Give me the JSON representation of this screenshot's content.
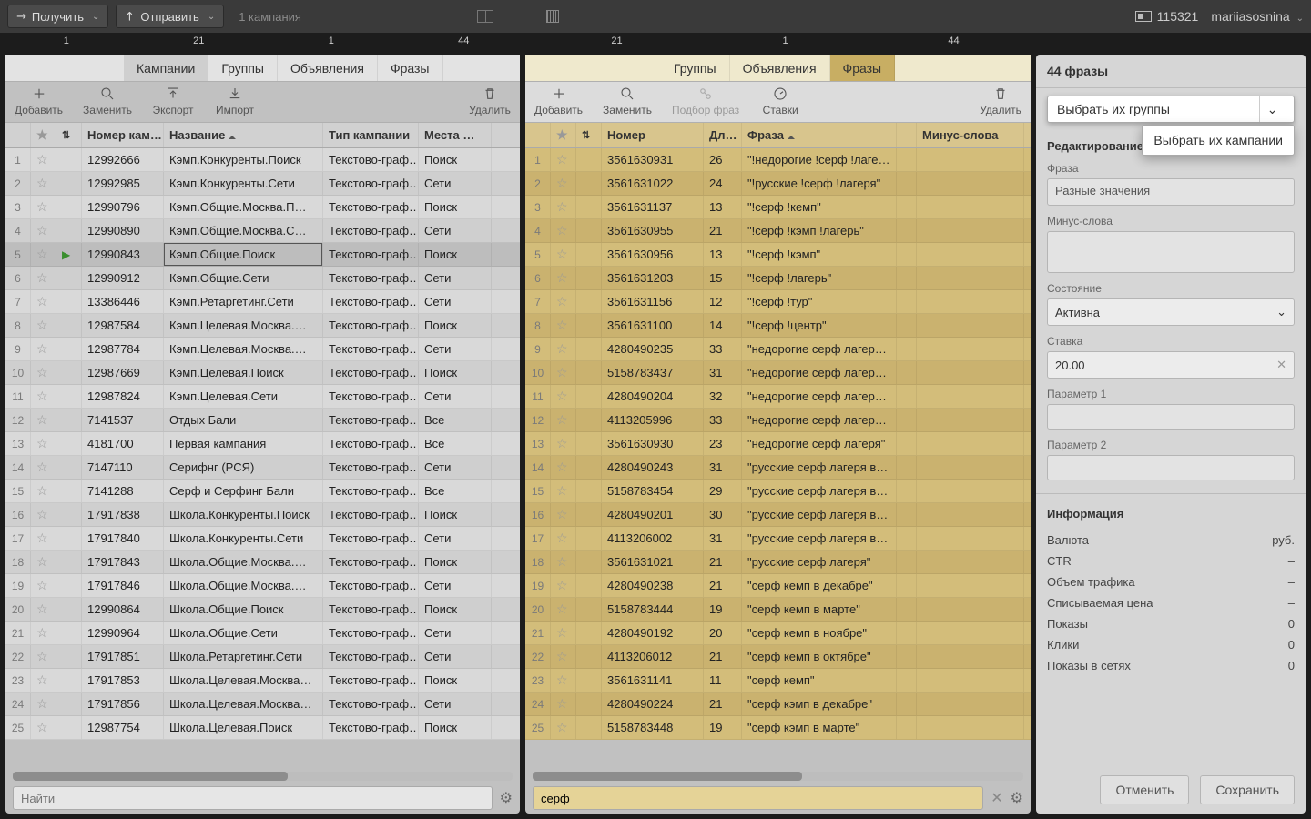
{
  "topbar": {
    "receive": "Получить",
    "send": "Отправить",
    "campaign_count": "1 кампания",
    "clock": "115321",
    "user": "mariiasosnina"
  },
  "counts_left": [
    "1",
    "21",
    "1",
    "44"
  ],
  "counts_mid": [
    "21",
    "1",
    "44"
  ],
  "tabs_left": [
    "Кампании",
    "Группы",
    "Объявления",
    "Фразы"
  ],
  "tabs_mid": [
    "Группы",
    "Объявления",
    "Фразы"
  ],
  "tools": {
    "add": "Добавить",
    "replace": "Заменить",
    "export": "Экспорт",
    "import": "Импорт",
    "delete": "Удалить",
    "pick": "Подбор фраз",
    "bids": "Ставки"
  },
  "left_headers": {
    "num": "Номер кам…",
    "name": "Название",
    "type": "Тип кампании",
    "place": "Места …"
  },
  "mid_headers": {
    "num": "Номер",
    "len": "Дл…",
    "phrase": "Фраза",
    "minus": "Минус-слова"
  },
  "left_rows": [
    {
      "num": "12992666",
      "name": "Кэмп.Конкуренты.Поиск",
      "type": "Текстово-граф…",
      "place": "Поиск"
    },
    {
      "num": "12992985",
      "name": "Кэмп.Конкуренты.Сети",
      "type": "Текстово-граф…",
      "place": "Сети"
    },
    {
      "num": "12990796",
      "name": "Кэмп.Общие.Москва.П…",
      "type": "Текстово-граф…",
      "place": "Поиск"
    },
    {
      "num": "12990890",
      "name": "Кэмп.Общие.Москва.С…",
      "type": "Текстово-граф…",
      "place": "Сети"
    },
    {
      "num": "12990843",
      "name": "Кэмп.Общие.Поиск",
      "type": "Текстово-граф…",
      "place": "Поиск",
      "selected": true
    },
    {
      "num": "12990912",
      "name": "Кэмп.Общие.Сети",
      "type": "Текстово-граф…",
      "place": "Сети"
    },
    {
      "num": "13386446",
      "name": "Кэмп.Ретаргетинг.Сети",
      "type": "Текстово-граф…",
      "place": "Сети"
    },
    {
      "num": "12987584",
      "name": "Кэмп.Целевая.Москва.…",
      "type": "Текстово-граф…",
      "place": "Поиск"
    },
    {
      "num": "12987784",
      "name": "Кэмп.Целевая.Москва.…",
      "type": "Текстово-граф…",
      "place": "Сети"
    },
    {
      "num": "12987669",
      "name": "Кэмп.Целевая.Поиск",
      "type": "Текстово-граф…",
      "place": "Поиск"
    },
    {
      "num": "12987824",
      "name": "Кэмп.Целевая.Сети",
      "type": "Текстово-граф…",
      "place": "Сети"
    },
    {
      "num": "7141537",
      "name": "Отдых Бали",
      "type": "Текстово-граф…",
      "place": "Все"
    },
    {
      "num": "4181700",
      "name": "Первая кампания",
      "type": "Текстово-граф…",
      "place": "Все"
    },
    {
      "num": "7147110",
      "name": "Серифнг (РСЯ)",
      "type": "Текстово-граф…",
      "place": "Сети"
    },
    {
      "num": "7141288",
      "name": "Серф и Серфинг Бали",
      "type": "Текстово-граф…",
      "place": "Все"
    },
    {
      "num": "17917838",
      "name": "Школа.Конкуренты.Поиск",
      "type": "Текстово-граф…",
      "place": "Поиск"
    },
    {
      "num": "17917840",
      "name": "Школа.Конкуренты.Сети",
      "type": "Текстово-граф…",
      "place": "Сети"
    },
    {
      "num": "17917843",
      "name": "Школа.Общие.Москва.…",
      "type": "Текстово-граф…",
      "place": "Поиск"
    },
    {
      "num": "17917846",
      "name": "Школа.Общие.Москва.…",
      "type": "Текстово-граф…",
      "place": "Сети"
    },
    {
      "num": "12990864",
      "name": "Школа.Общие.Поиск",
      "type": "Текстово-граф…",
      "place": "Поиск"
    },
    {
      "num": "12990964",
      "name": "Школа.Общие.Сети",
      "type": "Текстово-граф…",
      "place": "Сети"
    },
    {
      "num": "17917851",
      "name": "Школа.Ретаргетинг.Сети",
      "type": "Текстово-граф…",
      "place": "Сети"
    },
    {
      "num": "17917853",
      "name": "Школа.Целевая.Москва…",
      "type": "Текстово-граф…",
      "place": "Поиск"
    },
    {
      "num": "17917856",
      "name": "Школа.Целевая.Москва…",
      "type": "Текстово-граф…",
      "place": "Сети"
    },
    {
      "num": "12987754",
      "name": "Школа.Целевая.Поиск",
      "type": "Текстово-граф…",
      "place": "Поиск"
    }
  ],
  "mid_rows": [
    {
      "num": "3561630931",
      "len": "26",
      "phrase": "\"!недорогие !серф !лаге…"
    },
    {
      "num": "3561631022",
      "len": "24",
      "phrase": "\"!русские !серф !лагеря\""
    },
    {
      "num": "3561631137",
      "len": "13",
      "phrase": "\"!серф !кемп\""
    },
    {
      "num": "3561630955",
      "len": "21",
      "phrase": "\"!серф !кэмп !лагерь\""
    },
    {
      "num": "3561630956",
      "len": "13",
      "phrase": "\"!серф !кэмп\""
    },
    {
      "num": "3561631203",
      "len": "15",
      "phrase": "\"!серф !лагерь\""
    },
    {
      "num": "3561631156",
      "len": "12",
      "phrase": "\"!серф !тур\""
    },
    {
      "num": "3561631100",
      "len": "14",
      "phrase": "\"!серф !центр\""
    },
    {
      "num": "4280490235",
      "len": "33",
      "phrase": "\"недорогие серф лагер…"
    },
    {
      "num": "5158783437",
      "len": "31",
      "phrase": "\"недорогие серф лагер…"
    },
    {
      "num": "4280490204",
      "len": "32",
      "phrase": "\"недорогие серф лагер…"
    },
    {
      "num": "4113205996",
      "len": "33",
      "phrase": "\"недорогие серф лагер…"
    },
    {
      "num": "3561630930",
      "len": "23",
      "phrase": "\"недорогие серф лагеря\""
    },
    {
      "num": "4280490243",
      "len": "31",
      "phrase": "\"русские серф лагеря в…"
    },
    {
      "num": "5158783454",
      "len": "29",
      "phrase": "\"русские серф лагеря в…"
    },
    {
      "num": "4280490201",
      "len": "30",
      "phrase": "\"русские серф лагеря в…"
    },
    {
      "num": "4113206002",
      "len": "31",
      "phrase": "\"русские серф лагеря в…"
    },
    {
      "num": "3561631021",
      "len": "21",
      "phrase": "\"русские серф лагеря\""
    },
    {
      "num": "4280490238",
      "len": "21",
      "phrase": "\"серф кемп в декабре\""
    },
    {
      "num": "5158783444",
      "len": "19",
      "phrase": "\"серф кемп в марте\""
    },
    {
      "num": "4280490192",
      "len": "20",
      "phrase": "\"серф кемп в ноябре\""
    },
    {
      "num": "4113206012",
      "len": "21",
      "phrase": "\"серф кемп в октябре\""
    },
    {
      "num": "3561631141",
      "len": "11",
      "phrase": "\"серф кемп\""
    },
    {
      "num": "4280490224",
      "len": "21",
      "phrase": "\"серф кэмп в декабре\""
    },
    {
      "num": "5158783448",
      "len": "19",
      "phrase": "\"серф кэмп в марте\""
    }
  ],
  "search": {
    "left_placeholder": "Найти",
    "mid_value": "серф"
  },
  "right": {
    "title": "44 фразы",
    "select_groups": "Выбрать их группы",
    "select_campaigns": "Выбрать их кампании",
    "editing": "Редактирование",
    "labels": {
      "phrase": "Фраза",
      "minus": "Минус-слова",
      "state": "Состояние",
      "bid": "Ставка",
      "p1": "Параметр 1",
      "p2": "Параметр 2"
    },
    "phrase_value": "Разные значения",
    "state_value": "Активна",
    "bid_value": "20.00",
    "info_title": "Информация",
    "info": [
      {
        "k": "Валюта",
        "v": "руб."
      },
      {
        "k": "CTR",
        "v": "–"
      },
      {
        "k": "Объем трафика",
        "v": "–"
      },
      {
        "k": "Списываемая цена",
        "v": "–"
      },
      {
        "k": "Показы",
        "v": "0"
      },
      {
        "k": "Клики",
        "v": "0"
      },
      {
        "k": "Показы в сетях",
        "v": "0"
      }
    ],
    "cancel": "Отменить",
    "save": "Сохранить"
  }
}
